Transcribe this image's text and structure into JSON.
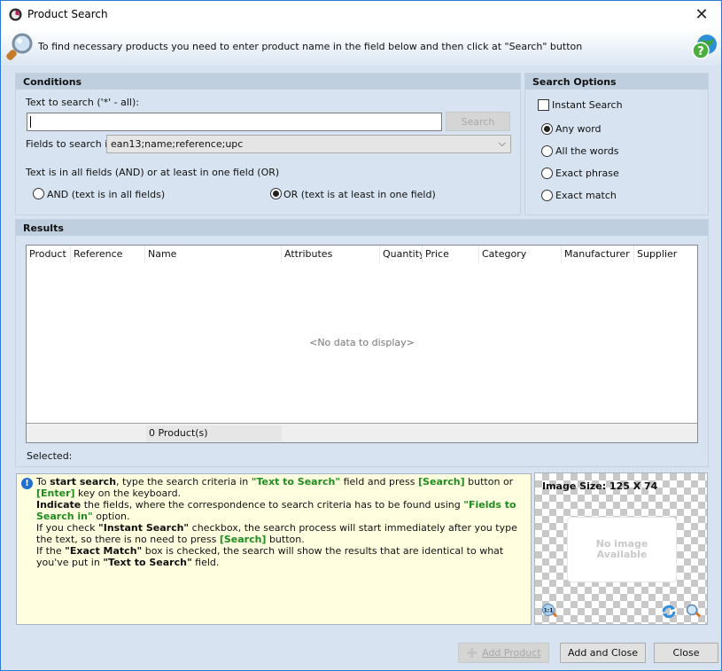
{
  "window": {
    "title": "Product Search",
    "close_icon": "close-icon",
    "app_icon": "app-logo-icon"
  },
  "infobar": {
    "text": "To find necessary products you need to enter product name in the field below and then click at \"Search\" button",
    "left_icon": "magnifier-icon",
    "right_icon": "help-globe-icon"
  },
  "conditions": {
    "header": "Conditions",
    "text_to_search_label": "Text to search ('*' - all):",
    "text_to_search_value": "",
    "search_button": "Search",
    "fields_label": "Fields to search in",
    "fields_value": "ean13;name;reference;upc",
    "logic_label": "Text is in all fields (AND) or at least in one field (OR)",
    "and_option": "AND (text is in all fields)",
    "or_option": "OR (text is at least in one field)",
    "selected_logic": "OR"
  },
  "search_options": {
    "header": "Search Options",
    "instant_search_label": "Instant Search",
    "instant_search_checked": false,
    "modes": [
      {
        "label": "Any word",
        "checked": true
      },
      {
        "label": "All the words",
        "checked": false
      },
      {
        "label": "Exact phrase",
        "checked": false
      },
      {
        "label": "Exact match",
        "checked": false
      }
    ]
  },
  "results": {
    "header": "Results",
    "columns": [
      "Product I",
      "Reference",
      "Name",
      "Attributes",
      "Quantity",
      "Price",
      "Category",
      "Manufacturer",
      "Supplier"
    ],
    "empty_text": "<No data to display>",
    "footer_count": "0 Product(s)",
    "selected_label": "Selected:"
  },
  "hint": {
    "icon": "info-icon",
    "p1_a": "To ",
    "p1_b": "start search",
    "p1_c": ", type the search criteria in ",
    "p1_d": "\"Text to Search\"",
    "p1_e": " field and press ",
    "p1_f": "[Search]",
    "p1_g": " button or ",
    "p1_h": "[Enter]",
    "p1_i": " key on the keyboard.",
    "p2_a": "Indicate",
    "p2_b": " the fields, where the correspondence to search criteria has to be found using ",
    "p2_c": "\"Fields to Search in\"",
    "p2_d": " option.",
    "p3_a": "If you check ",
    "p3_b": "\"Instant Search\"",
    "p3_c": " checkbox, the search process will start immediately after you type the text, so there is no need to press ",
    "p3_d": "[Search]",
    "p3_e": " button.",
    "p4_a": "If the ",
    "p4_b": "\"Exact Match\"",
    "p4_c": " box is checked, the search will show the results that are identical to what you've put in ",
    "p4_d": "\"Text to Search\"",
    "p4_e": " field."
  },
  "image_panel": {
    "size_label": "Image Size: 125 X 74",
    "no_image_line1": "No image",
    "no_image_line2": "Available",
    "tools": [
      "zoom-actual-size-icon",
      "refresh-icon",
      "zoom-icon"
    ],
    "actual_size_text": "1:1"
  },
  "buttons": {
    "add_product": "Add Product",
    "add_and_close": "Add and Close",
    "close": "Close"
  }
}
